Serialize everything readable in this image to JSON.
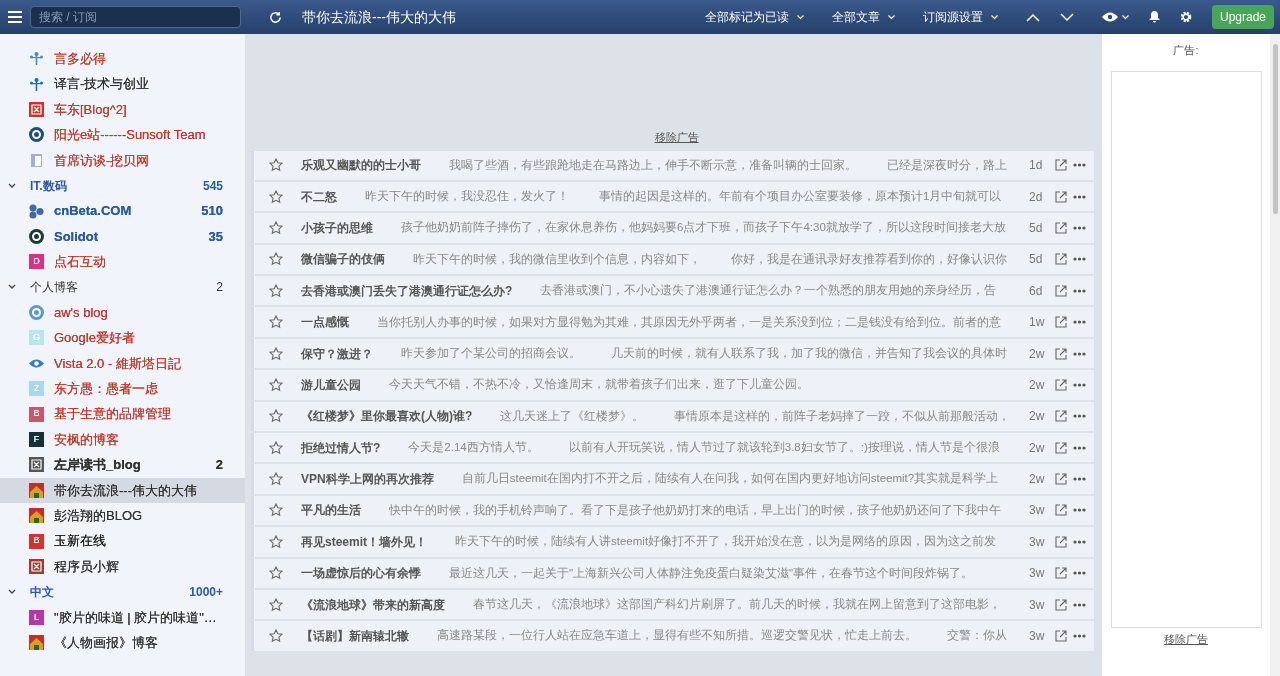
{
  "search": {
    "placeholder": "搜索 / 订阅"
  },
  "header": {
    "title": "带你去流浪---伟大的大伟",
    "menus": [
      {
        "label": "全部标记为已读"
      },
      {
        "label": "全部文章"
      },
      {
        "label": "订阅源设置"
      }
    ],
    "upgrade": "Upgrade"
  },
  "sidebar": {
    "items": [
      {
        "kind": "feed",
        "name": "言多必得",
        "color": "#c0392b",
        "unread": false,
        "selected": false,
        "icon": {
          "kind": "tree",
          "color": "#3a8fc9"
        }
      },
      {
        "kind": "feed",
        "name": "译言-技术与创业",
        "color": "#333333",
        "unread": false,
        "selected": false,
        "icon": {
          "kind": "tree",
          "color": "#1f6fb0"
        }
      },
      {
        "kind": "feed",
        "name": "车东[Blog^2]",
        "color": "#c0392b",
        "unread": false,
        "selected": false,
        "icon": {
          "kind": "seal",
          "color": "#c0392b"
        }
      },
      {
        "kind": "feed",
        "name": "阳光e站------Sunsoft Team",
        "color": "#c0392b",
        "unread": false,
        "selected": false,
        "icon": {
          "kind": "ring",
          "color": "#1e4f7a"
        }
      },
      {
        "kind": "feed",
        "name": "首席访谈-挖贝网",
        "color": "#c0392b",
        "unread": false,
        "selected": false,
        "icon": {
          "kind": "page",
          "color": "#9cb4d0"
        }
      },
      {
        "kind": "folder",
        "name": "IT.数码",
        "color": "#2b5aa8",
        "unread": true,
        "expanded": true,
        "count": "545"
      },
      {
        "kind": "feed",
        "name": "cnBeta.COM",
        "color": "#2b5aa8",
        "unread": true,
        "selected": false,
        "count": "510",
        "icon": {
          "kind": "dots",
          "color": "#3b6aa8"
        }
      },
      {
        "kind": "feed",
        "name": "Solidot",
        "color": "#2b5aa8",
        "unread": true,
        "selected": false,
        "count": "35",
        "icon": {
          "kind": "ring",
          "color": "#1d3b30"
        }
      },
      {
        "kind": "feed",
        "name": "点石互动",
        "color": "#c0392b",
        "unread": false,
        "selected": false,
        "icon": {
          "kind": "letter",
          "letter": "D",
          "color": "#d63384"
        }
      },
      {
        "kind": "folder",
        "name": "个人博客",
        "color": "#333333",
        "unread": false,
        "expanded": true,
        "count": "2"
      },
      {
        "kind": "feed",
        "name": "aw's blog",
        "color": "#c0392b",
        "unread": false,
        "selected": false,
        "icon": {
          "kind": "ring",
          "color": "#5b9ac7"
        }
      },
      {
        "kind": "feed",
        "name": "Google爱好者",
        "color": "#c0392b",
        "unread": false,
        "selected": false,
        "icon": {
          "kind": "letter",
          "letter": "G",
          "color": "#b9e6ec"
        }
      },
      {
        "kind": "feed",
        "name": "Vista 2.0 - 維斯塔日記",
        "color": "#c0392b",
        "unread": false,
        "selected": false,
        "icon": {
          "kind": "eye",
          "color": "#2f7fbf"
        }
      },
      {
        "kind": "feed",
        "name": "东方愚：愚者一虑",
        "color": "#c0392b",
        "unread": false,
        "selected": false,
        "icon": {
          "kind": "letter",
          "letter": "Z",
          "color": "#a8d8f0"
        }
      },
      {
        "kind": "feed",
        "name": "基于生意的品牌管理",
        "color": "#c0392b",
        "unread": false,
        "selected": false,
        "icon": {
          "kind": "letter",
          "letter": "B",
          "color": "#c9566b"
        }
      },
      {
        "kind": "feed",
        "name": "安枫的博客",
        "color": "#c0392b",
        "unread": false,
        "selected": false,
        "icon": {
          "kind": "letter",
          "letter": "F",
          "color": "#17303a"
        }
      },
      {
        "kind": "feed",
        "name": "左岸读书_blog",
        "color": "#333333",
        "unread": true,
        "selected": false,
        "count": "2",
        "icon": {
          "kind": "seal",
          "color": "#555555"
        }
      },
      {
        "kind": "feed",
        "name": "带你去流浪---伟大的大伟",
        "color": "#333333",
        "unread": false,
        "selected": true,
        "icon": {
          "kind": "house",
          "color": "#d8a020"
        }
      },
      {
        "kind": "feed",
        "name": "彭浩翔的BLOG",
        "color": "#333333",
        "unread": false,
        "selected": false,
        "icon": {
          "kind": "house",
          "color": "#d8a020"
        }
      },
      {
        "kind": "feed",
        "name": "玉新在线",
        "color": "#222222",
        "unread": false,
        "selected": false,
        "icon": {
          "kind": "letter",
          "letter": "B",
          "color": "#d0342c"
        }
      },
      {
        "kind": "feed",
        "name": "程序员小辉",
        "color": "#333333",
        "unread": false,
        "selected": false,
        "icon": {
          "kind": "seal",
          "color": "#a33a2c"
        }
      },
      {
        "kind": "folder",
        "name": "中文",
        "color": "#2b5aa8",
        "unread": true,
        "expanded": true,
        "count": "1000+"
      },
      {
        "kind": "feed",
        "name": "\"胶片的味道 | 胶片的味道\"…",
        "color": "#333333",
        "unread": false,
        "selected": false,
        "icon": {
          "kind": "letter",
          "letter": "L",
          "color": "#b03aa8"
        }
      },
      {
        "kind": "feed",
        "name": "《人物画报》博客",
        "color": "#333333",
        "unread": false,
        "selected": false,
        "icon": {
          "kind": "house",
          "color": "#d8a020"
        }
      }
    ]
  },
  "ad_banner": {
    "remove_link": "移除广告"
  },
  "articles": [
    {
      "title": "乐观又幽默的的士小哥",
      "snippet": [
        "我喝了些酒，有些踉跄地走在马路边上，伸手不断示意，准备叫辆的士回家。",
        "已经是深夜时分，路上"
      ],
      "age": "1d",
      "starred": false
    },
    {
      "title": "不二怒",
      "snippet": [
        "昨天下午的时候，我没忍住，发火了！",
        "事情的起因是这样的。年前有个项目办公室要装修，原本预计1月中旬就可以"
      ],
      "age": "2d",
      "starred": false
    },
    {
      "title": "小孩子的思维",
      "snippet": [
        "孩子他奶奶前阵子摔伤了，在家休息养伤，他妈妈要6点才下班，而孩子下午4:30就放学了，所以这段时间接老大放"
      ],
      "age": "5d",
      "starred": false
    },
    {
      "title": "微信骗子的伎俩",
      "snippet": [
        "昨天下午的时候，我的微信里收到个信息，内容如下，",
        "你好，我是在通讯录好友推荐看到你的，好像认识你"
      ],
      "age": "5d",
      "starred": false
    },
    {
      "title": "去香港或澳门丢失了港澳通行证怎么办?",
      "snippet": [
        "去香港或澳门，不小心遗失了港澳通行证怎么办？一个熟悉的朋友用她的亲身经历，告"
      ],
      "age": "6d",
      "starred": false
    },
    {
      "title": "一点感慨",
      "snippet": [
        "当你托别人办事的时候，如果对方显得勉为其难，其原因无外乎两者，一是关系没到位；二是钱没有给到位。前者的意"
      ],
      "age": "1w",
      "starred": false
    },
    {
      "title": "保守？激进？",
      "snippet": [
        "昨天参加了个某公司的招商会议。",
        "几天前的时候，就有人联系了我，加了我的微信，并告知了我会议的具体时"
      ],
      "age": "2w",
      "starred": false
    },
    {
      "title": "游儿童公园",
      "snippet": [
        "今天天气不错，不热不冷，又恰逢周末，就带着孩子们出来，逛了下儿童公园。"
      ],
      "age": "2w",
      "starred": false
    },
    {
      "title": "《红楼梦》里你最喜欢(人物)谁?",
      "snippet": [
        "这几天迷上了《红楼梦》。",
        "事情原本是这样的，前阵子老妈摔了一跤，不似从前那般活动，"
      ],
      "age": "2w",
      "starred": false
    },
    {
      "title": "拒绝过情人节?",
      "snippet": [
        "今天是2.14西方情人节。",
        "以前有人开玩笑说，情人节过了就该轮到3.8妇女节了。:)按理说，情人节是个很浪"
      ],
      "age": "2w",
      "starred": false
    },
    {
      "title": "VPN科学上网的再次推荐",
      "snippet": [
        "自前几日steemit在国内打不开之后，陆续有人在问我，如何在国内更好地访问steemit?其实就是科学上"
      ],
      "age": "2w",
      "starred": false
    },
    {
      "title": "平凡的生活",
      "snippet": [
        "快中午的时候，我的手机铃声响了。看了下是孩子他奶奶打来的电话，早上出门的时候，孩子他奶奶还问了下我中午"
      ],
      "age": "3w",
      "starred": false
    },
    {
      "title": "再见steemit！墙外见！",
      "snippet": [
        "昨天下午的时候，陆续有人讲steemit好像打不开了，我开始没在意，以为是网络的原因，因为这之前发"
      ],
      "age": "3w",
      "starred": false
    },
    {
      "title": "一场虚惊后的心有余悸",
      "snippet": [
        "最近这几天，一起关于\"上海新兴公司人体静注免疫蛋白疑染艾滋\"事件，在春节这个时间段炸锅了。"
      ],
      "age": "3w",
      "starred": false
    },
    {
      "title": "《流浪地球》带来的新高度",
      "snippet": [
        "春节这几天，《流浪地球》这部国产科幻片刷屏了。前几天的时候，我就在网上留意到了这部电影，"
      ],
      "age": "3w",
      "starred": false
    },
    {
      "title": "【话剧】新南辕北辙",
      "snippet": [
        "高速路某段，一位行人站在应急车道上，显得有些不知所措。巡逻交警见状，忙走上前去。",
        "交警：你从"
      ],
      "age": "3w",
      "starred": false
    }
  ],
  "ad_panel": {
    "label": "广告:",
    "remove_link": "移除广告"
  }
}
